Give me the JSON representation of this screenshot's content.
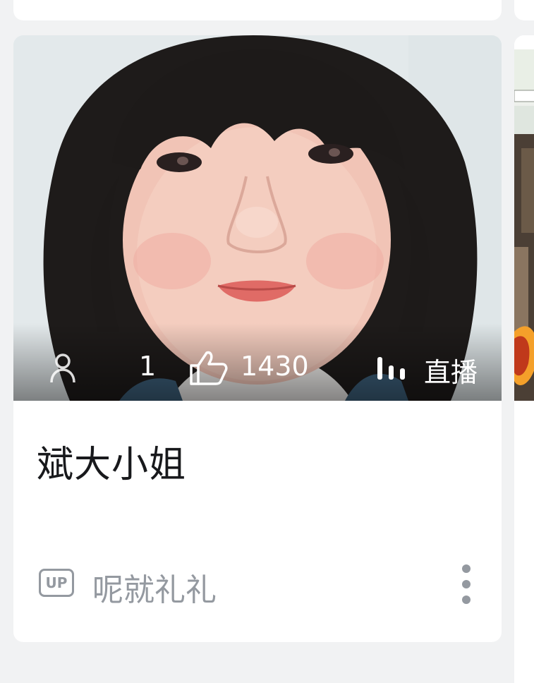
{
  "card": {
    "stats": {
      "viewers": "1",
      "likes": "1430",
      "live_label": "直播"
    },
    "title": "斌大小姐",
    "owner": {
      "badge": "UP",
      "name": "呢就礼礼"
    }
  },
  "icons": {
    "viewers": "person-icon",
    "likes": "thumbs-up-icon",
    "live": "live-bars-icon",
    "more": "more-vertical-icon"
  },
  "colors": {
    "title": "#18191c",
    "meta": "#9499a0",
    "background": "#f1f2f3",
    "card": "#ffffff"
  }
}
